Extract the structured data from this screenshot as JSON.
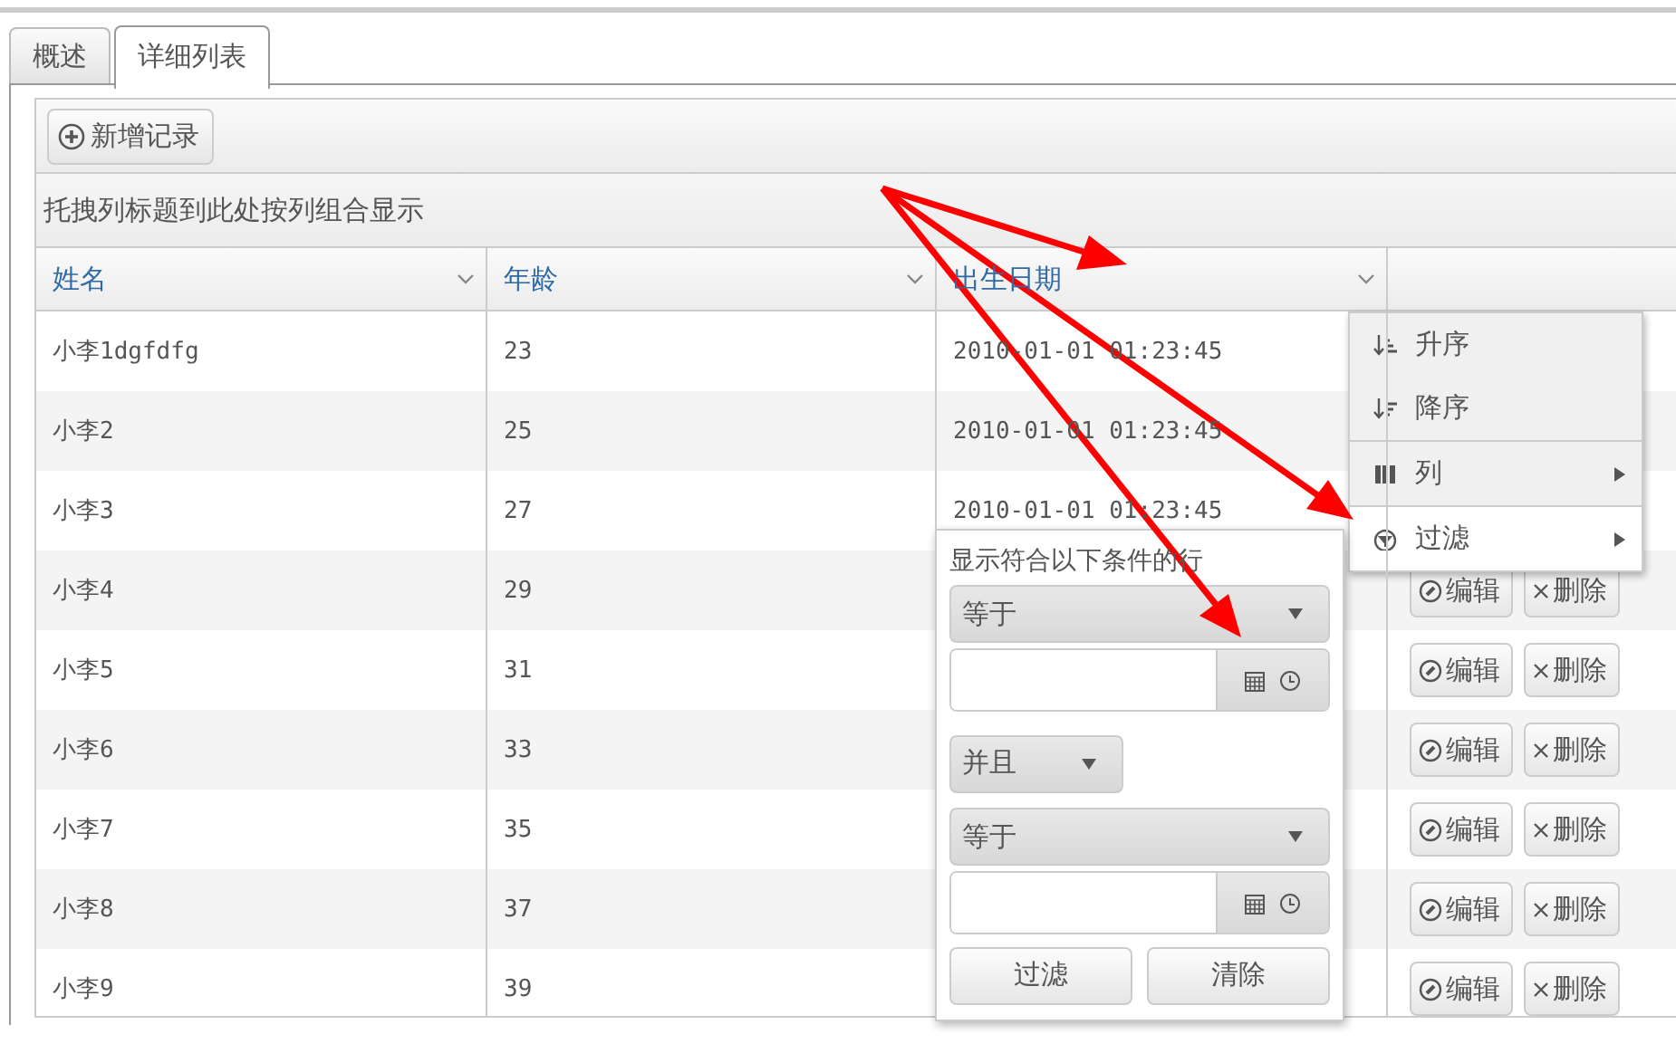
{
  "tabs": [
    {
      "label": "概述",
      "selected": false
    },
    {
      "label": "详细列表",
      "selected": true
    }
  ],
  "toolbar": {
    "add_button": "新增记录"
  },
  "group_panel": {
    "hint": "托拽列标题到此处按列组合显示"
  },
  "table": {
    "columns": [
      {
        "label": "姓名"
      },
      {
        "label": "年龄"
      },
      {
        "label": "出生日期"
      },
      {}
    ],
    "rows": [
      {
        "name": "小李1dgfdfg",
        "age": "23",
        "birth": "2010-01-01 01:23:45"
      },
      {
        "name": "小李2",
        "age": "25",
        "birth": "2010-01-01 01:23:45"
      },
      {
        "name": "小李3",
        "age": "27",
        "birth": "2010-01-01 01:23:45"
      },
      {
        "name": "小李4",
        "age": "29",
        "actions": [
          "编辑",
          "删除"
        ]
      },
      {
        "name": "小李5",
        "age": "31",
        "actions": [
          "编辑",
          "删除"
        ]
      },
      {
        "name": "小李6",
        "age": "33",
        "actions": [
          "编辑",
          "删除"
        ]
      },
      {
        "name": "小李7",
        "age": "35",
        "actions": [
          "编辑",
          "删除"
        ]
      },
      {
        "name": "小李8",
        "age": "37",
        "actions": [
          "编辑",
          "删除"
        ]
      },
      {
        "name": "小李9",
        "age": "39",
        "actions": [
          "编辑",
          "删除"
        ]
      }
    ]
  },
  "column_menu": {
    "items": [
      {
        "kind": "sort_asc",
        "label": "升序",
        "submenu": false,
        "selected": false
      },
      {
        "kind": "sort_desc",
        "label": "降序",
        "submenu": false,
        "selected": false
      },
      {
        "kind": "columns",
        "label": "列",
        "submenu": true,
        "selected": false
      },
      {
        "kind": "filter",
        "label": "过滤",
        "submenu": true,
        "selected": true
      }
    ]
  },
  "filter_popup": {
    "title": "显示符合以下条件的行",
    "operator_1": "等于",
    "logic": "并且",
    "operator_2": "等于",
    "buttons": [
      "过滤",
      "清除"
    ]
  }
}
